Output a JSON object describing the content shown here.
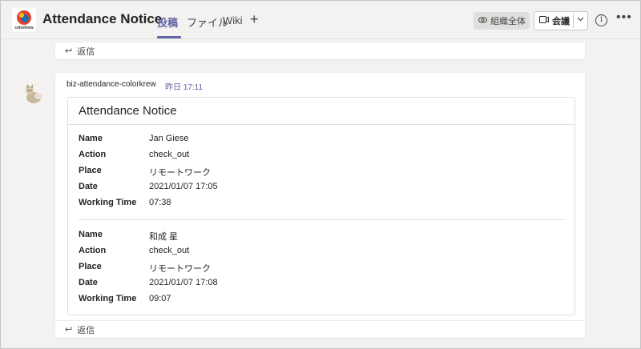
{
  "header": {
    "title": "Attendance Notice",
    "logo_text": "colorkrew",
    "tabs": [
      {
        "label": "投稿",
        "active": true
      },
      {
        "label": "ファイル",
        "active": false
      },
      {
        "label": "Wiki",
        "active": false
      }
    ],
    "add_tab_icon": "plus-icon",
    "org_pill_label": "組織全体",
    "meet_label": "会議",
    "accent_color": "#6264a7"
  },
  "reply_label": "返信",
  "message": {
    "sender": "biz-attendance-colorkrew",
    "time": "昨日 17:11",
    "card_title": "Attendance Notice",
    "records": [
      {
        "fields": [
          {
            "label": "Name",
            "value": "Jan Giese"
          },
          {
            "label": "Action",
            "value": "check_out"
          },
          {
            "label": "Place",
            "value": "リモートワーク"
          },
          {
            "label": "Date",
            "value": "2021/01/07 17:05"
          },
          {
            "label": "Working Time",
            "value": "07:38"
          }
        ]
      },
      {
        "fields": [
          {
            "label": "Name",
            "value": "和成 星"
          },
          {
            "label": "Action",
            "value": "check_out"
          },
          {
            "label": "Place",
            "value": "リモートワーク"
          },
          {
            "label": "Date",
            "value": "2021/01/07 17:08"
          },
          {
            "label": "Working Time",
            "value": "09:07"
          }
        ]
      }
    ]
  }
}
